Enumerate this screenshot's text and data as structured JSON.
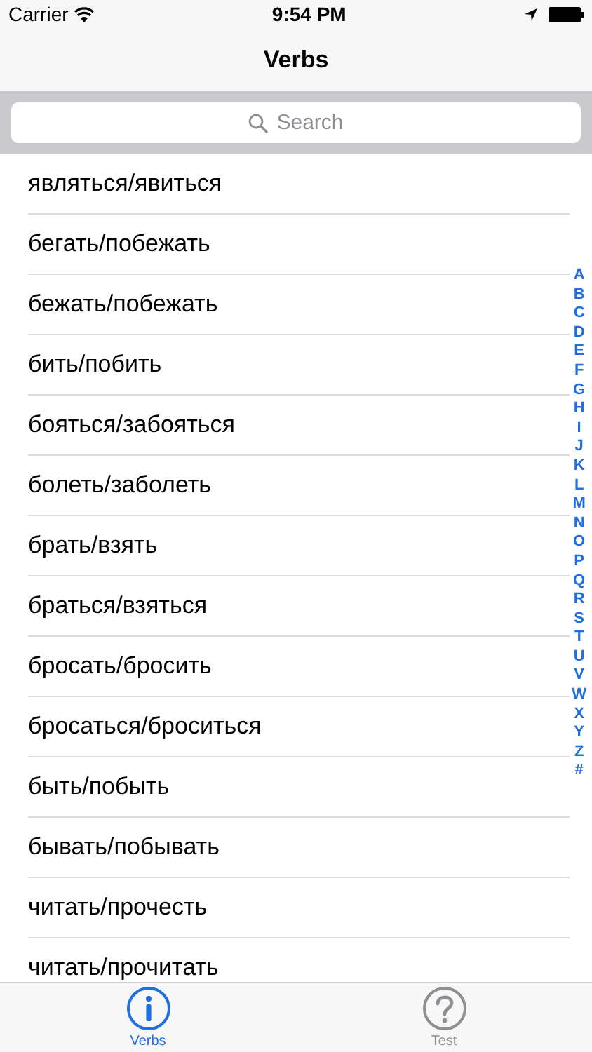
{
  "status_bar": {
    "carrier": "Carrier",
    "time": "9:54 PM"
  },
  "nav_bar": {
    "title": "Verbs"
  },
  "search": {
    "placeholder": "Search"
  },
  "verbs": [
    "являться/явиться",
    "бегать/побежать",
    "бежать/побежать",
    "бить/побить",
    "бояться/забояться",
    "болеть/заболеть",
    "брать/взять",
    "браться/взяться",
    "бросать/бросить",
    "бросаться/броситься",
    "быть/побыть",
    "бывать/побывать",
    "читать/прочесть",
    "читать/прочитать"
  ],
  "index": [
    "A",
    "B",
    "C",
    "D",
    "E",
    "F",
    "G",
    "H",
    "I",
    "J",
    "K",
    "L",
    "M",
    "N",
    "O",
    "P",
    "Q",
    "R",
    "S",
    "T",
    "U",
    "V",
    "W",
    "X",
    "Y",
    "Z",
    "#"
  ],
  "tabs": [
    {
      "label": "Verbs",
      "kind": "info",
      "selected": true
    },
    {
      "label": "Test",
      "kind": "question",
      "selected": false
    }
  ]
}
